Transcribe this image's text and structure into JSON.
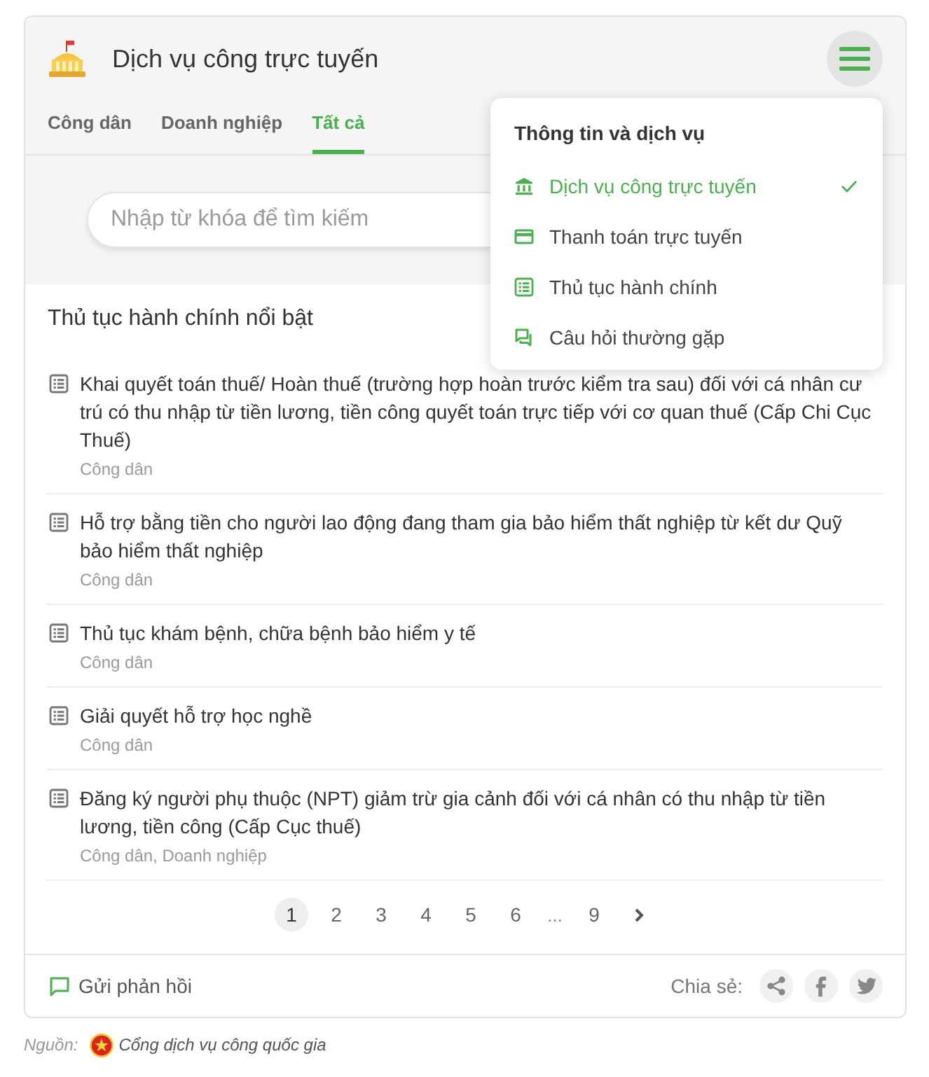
{
  "header": {
    "title": "Dịch vụ công trực tuyến"
  },
  "menu": {
    "open": true,
    "title": "Thông tin và dịch vụ",
    "items": [
      {
        "label": "Dịch vụ công trực tuyến",
        "selected": true
      },
      {
        "label": "Thanh toán trực tuyến",
        "selected": false
      },
      {
        "label": "Thủ tục hành chính",
        "selected": false
      },
      {
        "label": "Câu hỏi thường gặp",
        "selected": false
      }
    ]
  },
  "tabs": [
    {
      "label": "Công dân",
      "selected": false
    },
    {
      "label": "Doanh nghiệp",
      "selected": false
    },
    {
      "label": "Tất cả",
      "selected": true
    }
  ],
  "search": {
    "placeholder": "Nhập từ khóa để tìm kiếm"
  },
  "featured": {
    "title": "Thủ tục hành chính nổi bật",
    "items": [
      {
        "title": "Khai quyết toán thuế/ Hoàn thuế (trường hợp hoàn trước kiểm tra sau) đối với cá nhân cư trú có thu nhập từ tiền lương, tiền công quyết toán trực tiếp với cơ quan thuế (Cấp Chi Cục Thuế)",
        "category": "Công dân"
      },
      {
        "title": "Hỗ trợ bằng tiền cho người lao động đang tham gia bảo hiểm thất nghiệp từ kết dư Quỹ bảo hiểm thất nghiệp",
        "category": "Công dân"
      },
      {
        "title": "Thủ tục khám bệnh, chữa bệnh bảo hiểm y tế",
        "category": "Công dân"
      },
      {
        "title": "Giải quyết hỗ trợ học nghề",
        "category": "Công dân"
      },
      {
        "title": "Đăng ký người phụ thuộc (NPT) giảm trừ gia cảnh đối với cá nhân có thu nhập từ tiền lương, tiền công (Cấp Cục thuế)",
        "category": "Công dân, Doanh nghiệp"
      }
    ]
  },
  "pagination": {
    "pages": [
      {
        "label": "1",
        "selected": true
      },
      {
        "label": "2",
        "selected": false
      },
      {
        "label": "3",
        "selected": false
      },
      {
        "label": "4",
        "selected": false
      },
      {
        "label": "5",
        "selected": false
      },
      {
        "label": "6",
        "selected": false
      }
    ],
    "ellipsis": "...",
    "last_pages": [
      {
        "label": "9",
        "selected": false
      }
    ]
  },
  "footer": {
    "feedback": "Gửi phản hồi",
    "share_label": "Chia sẻ:"
  },
  "source": {
    "label": "Nguồn:",
    "name": "Cổng dịch vụ công quốc gia"
  }
}
